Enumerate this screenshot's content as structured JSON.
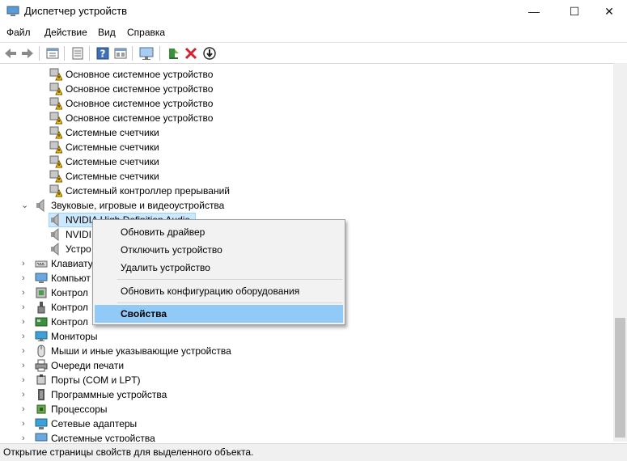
{
  "window": {
    "title": "Диспетчер устройств",
    "minimize": "—",
    "maximize": "☐",
    "close": "✕"
  },
  "menu": [
    "Файл",
    "Действие",
    "Вид",
    "Справка"
  ],
  "toolbar": {
    "icons": [
      "back-icon",
      "forward-icon",
      "device-view-icon",
      "properties-icon",
      "help-icon",
      "view-icon",
      "monitor-scan-icon",
      "update-driver-icon",
      "uninstall-icon",
      "download-icon"
    ]
  },
  "tree": {
    "items": [
      {
        "label": "Основное системное устройство",
        "icon": "warning-device-icon"
      },
      {
        "label": "Основное системное устройство",
        "icon": "warning-device-icon"
      },
      {
        "label": "Основное системное устройство",
        "icon": "warning-device-icon"
      },
      {
        "label": "Основное системное устройство",
        "icon": "warning-device-icon"
      },
      {
        "label": "Системные счетчики",
        "icon": "warning-device-icon"
      },
      {
        "label": "Системные счетчики",
        "icon": "warning-device-icon"
      },
      {
        "label": "Системные счетчики",
        "icon": "warning-device-icon"
      },
      {
        "label": "Системные счетчики",
        "icon": "warning-device-icon"
      },
      {
        "label": "Системный контроллер прерываний",
        "icon": "warning-device-icon"
      },
      {
        "label": "Звуковые, игровые и видеоустройства",
        "icon": "speaker-icon"
      },
      {
        "label": "NVIDIA High Definition Audio",
        "icon": "speaker-icon"
      },
      {
        "label": "NVIDI",
        "icon": "speaker-icon"
      },
      {
        "label": "Устро",
        "icon": "speaker-icon"
      },
      {
        "label": "Клавиату",
        "icon": "keyboard-icon"
      },
      {
        "label": "Компьют",
        "icon": "computer-icon"
      },
      {
        "label": "Контрол",
        "icon": "controller-icon"
      },
      {
        "label": "Контрол",
        "icon": "usb-icon"
      },
      {
        "label": "Контрол",
        "icon": "controller-icon"
      },
      {
        "label": "Мониторы",
        "icon": "monitor-icon"
      },
      {
        "label": "Мыши и иные указывающие устройства",
        "icon": "mouse-icon"
      },
      {
        "label": "Очереди печати",
        "icon": "printer-icon"
      },
      {
        "label": "Порты (COM и LPT)",
        "icon": "port-icon"
      },
      {
        "label": "Программные устройства",
        "icon": "software-device-icon"
      },
      {
        "label": "Процессоры",
        "icon": "cpu-icon"
      },
      {
        "label": "Сетевые адаптеры",
        "icon": "network-icon"
      },
      {
        "label": "Системные устройства",
        "icon": "system-device-icon"
      }
    ]
  },
  "context_menu": {
    "items": [
      "Обновить драйвер",
      "Отключить устройство",
      "Удалить устройство",
      "Обновить конфигурацию оборудования",
      "Свойства"
    ]
  },
  "status": "Открытие страницы свойств для выделенного объекта."
}
